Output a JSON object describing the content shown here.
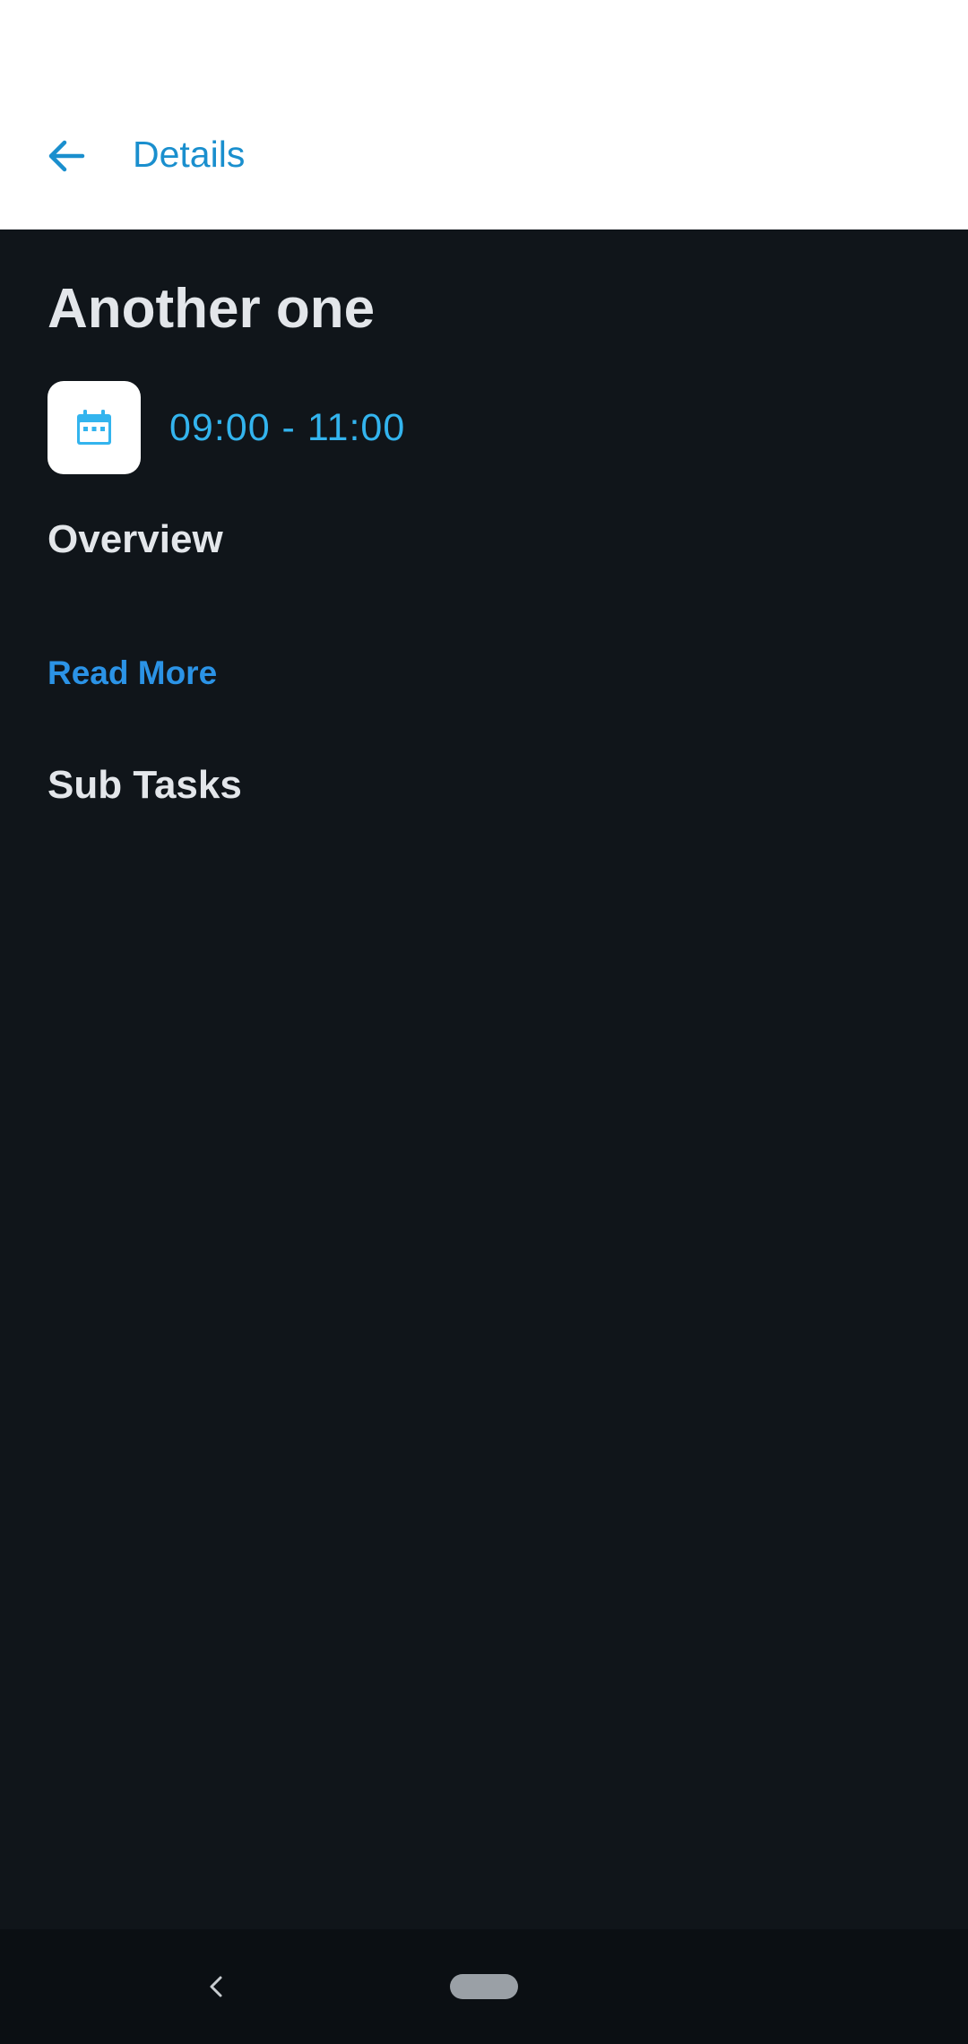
{
  "appbar": {
    "back_icon": "arrow-left-icon",
    "title": "Details",
    "accent": "#1a8fce"
  },
  "task": {
    "title": "Another one",
    "calendar_icon": "calendar-icon",
    "time_range": "09:00 - 11:00",
    "time_color": "#33b4ee"
  },
  "sections": {
    "overview_title": "Overview",
    "read_more": "Read More",
    "subtasks_title": "Sub Tasks"
  },
  "system_nav": {
    "back_icon": "chevron-left-icon",
    "home_icon": "home-pill-icon"
  }
}
